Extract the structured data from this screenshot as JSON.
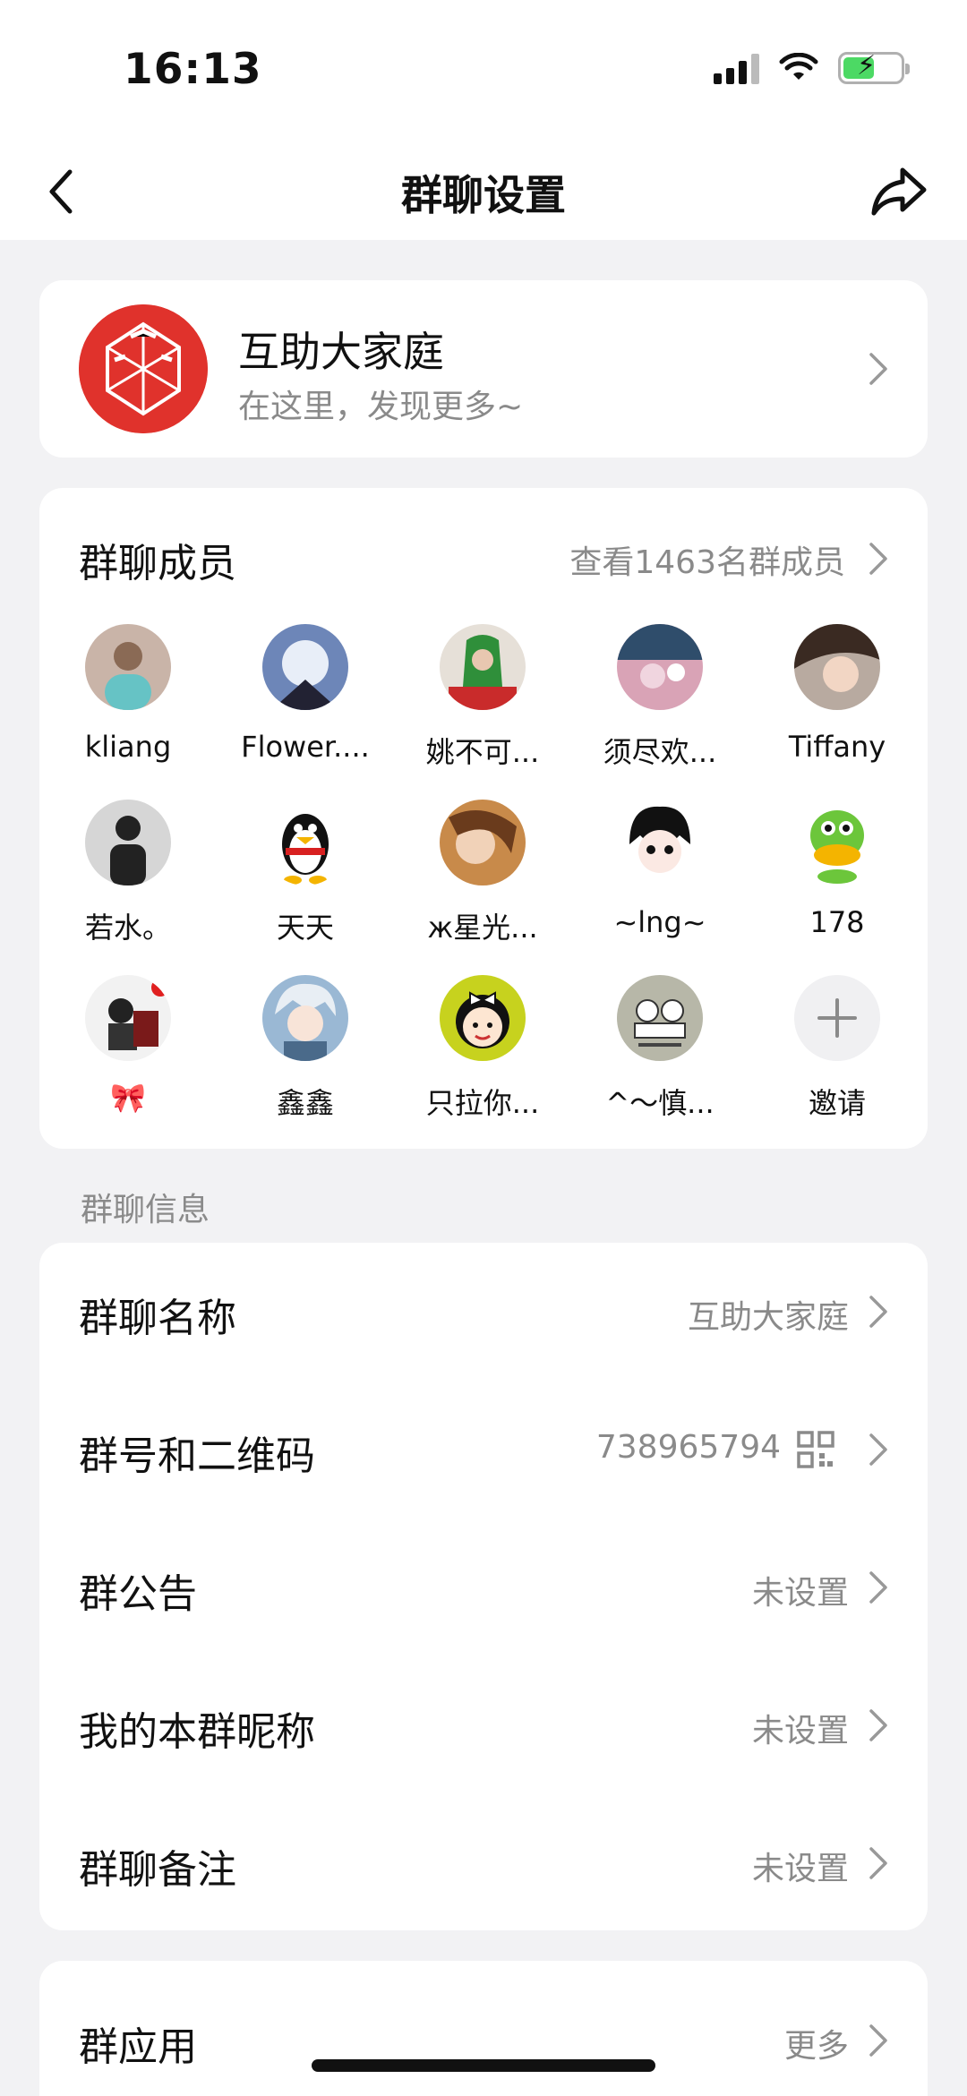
{
  "status_bar": {
    "time": "16:13"
  },
  "nav": {
    "title": "群聊设置"
  },
  "group": {
    "name": "互助大家庭",
    "description": "在这里，发现更多~"
  },
  "members": {
    "title": "群聊成员",
    "view_all": "查看1463名群成员",
    "list": [
      {
        "name": "kliang",
        "color": "#c9b4a8"
      },
      {
        "name": "Flower....",
        "color": "#6d86b8"
      },
      {
        "name": "姚不可...",
        "color": "#2f8f3a"
      },
      {
        "name": "须尽欢...",
        "color": "#d9a3b6"
      },
      {
        "name": "Tiffany",
        "color": "#a08f86"
      },
      {
        "name": "若水。",
        "color": "#3a3a3a"
      },
      {
        "name": "天天",
        "color": "#ffffff"
      },
      {
        "name": "ж星光...",
        "color": "#c88a4a"
      },
      {
        "name": "~lng~",
        "color": "#ffffff"
      },
      {
        "name": "178",
        "color": "#ffffff"
      },
      {
        "name": "🎀",
        "color": "#e9e9e9"
      },
      {
        "name": "鑫鑫",
        "color": "#9ab8d4"
      },
      {
        "name": "只拉你...",
        "color": "#c7d21e"
      },
      {
        "name": "^～慎...",
        "color": "#b7b7a8"
      }
    ],
    "invite_label": "邀请"
  },
  "section_label": "群聊信息",
  "info_rows": [
    {
      "label": "群聊名称",
      "value": "互助大家庭"
    },
    {
      "label": "群号和二维码",
      "value": "738965794"
    },
    {
      "label": "群公告",
      "value": "未设置"
    },
    {
      "label": "我的本群昵称",
      "value": "未设置"
    },
    {
      "label": "群聊备注",
      "value": "未设置"
    }
  ],
  "apps": {
    "label": "群应用",
    "value": "更多"
  },
  "icons": {
    "back": "chevron-left-icon",
    "share": "share-arrow-icon",
    "qr": "qr-code-icon",
    "invite": "plus-icon"
  }
}
